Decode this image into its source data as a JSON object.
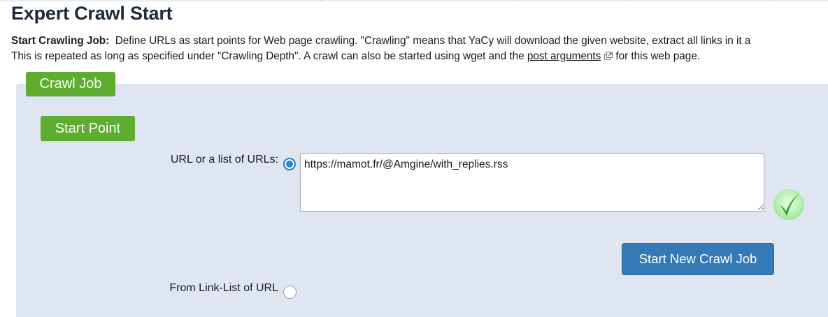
{
  "page": {
    "title": "Expert Crawl Start",
    "intro_bold": "Start Crawling Job:",
    "intro_line1": "Define URLs as start points for Web page crawling. \"Crawling\" means that YaCy will download the given website, extract all links in it a",
    "intro_line2_prefix": "This is repeated as long as specified under \"Crawling Depth\". A crawl can also be started using wget and the",
    "intro_link": "post arguments",
    "intro_line2_suffix": "for this web page."
  },
  "crawl_job": {
    "legend": "Crawl Job",
    "start_point": {
      "legend": "Start Point",
      "url_label": "URL or a list of URLs:",
      "url_value": "https://mamot.fr/@Amgine/with_replies.rss",
      "url_selected": true,
      "linklist_label": "From Link-List of URL",
      "linklist_selected": false,
      "status_icon": "checkmark-icon"
    },
    "submit_label": "Start New Crawl Job"
  },
  "colors": {
    "legend_bg": "#5fad2f",
    "panel_bg": "#dfe6f2",
    "primary_button": "#337ab7",
    "check_green": "#22a312"
  }
}
